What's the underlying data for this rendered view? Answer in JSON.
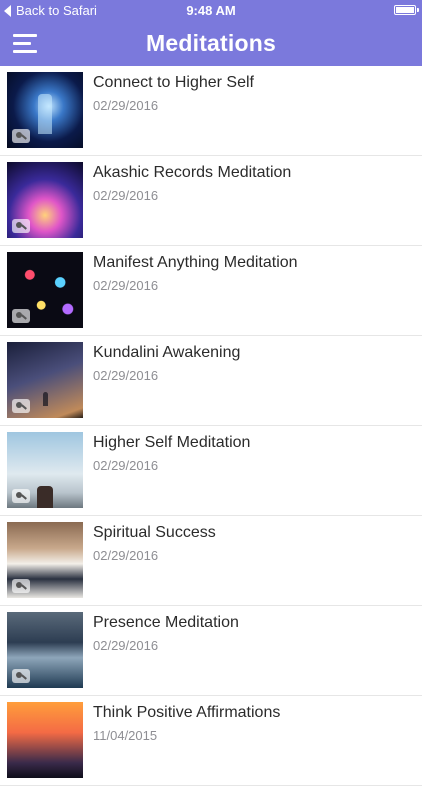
{
  "status_bar": {
    "back_label": "Back to Safari",
    "time": "9:48 AM"
  },
  "nav": {
    "title": "Meditations"
  },
  "colors": {
    "accent": "#7b79dc",
    "title_text": "#2b2b2b",
    "date_text": "#8e8e93"
  },
  "meditations": [
    {
      "title": "Connect to Higher Self",
      "date": "02/29/2016",
      "image": "cosmic-figure-image"
    },
    {
      "title": "Akashic Records Meditation",
      "date": "02/29/2016",
      "image": "glowing-book-image"
    },
    {
      "title": "Manifest Anything Meditation",
      "date": "02/29/2016",
      "image": "fireworks-image"
    },
    {
      "title": "Kundalini Awakening",
      "date": "02/29/2016",
      "image": "starry-sky-image"
    },
    {
      "title": "Higher Self Meditation",
      "date": "02/29/2016",
      "image": "person-sky-image"
    },
    {
      "title": "Spiritual Success",
      "date": "02/29/2016",
      "image": "reading-book-image"
    },
    {
      "title": "Presence Meditation",
      "date": "02/29/2016",
      "image": "stormy-sea-image"
    },
    {
      "title": "Think Positive Affirmations",
      "date": "11/04/2015",
      "image": "pier-sunset-image"
    }
  ]
}
